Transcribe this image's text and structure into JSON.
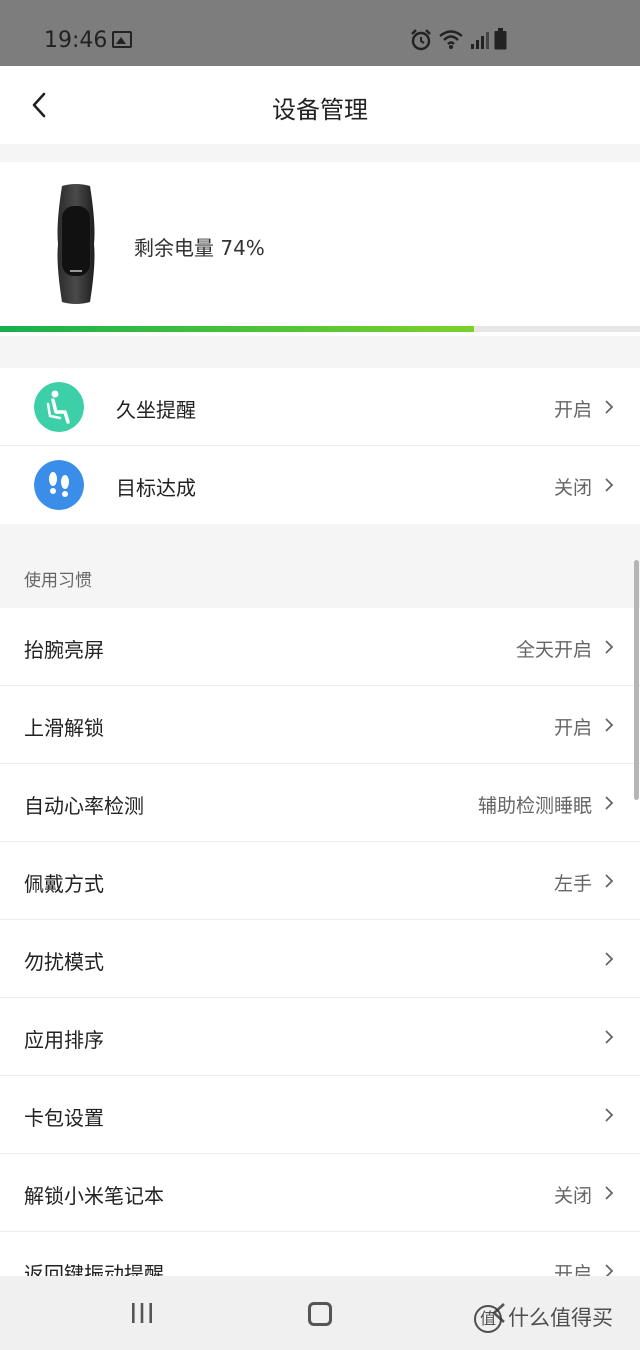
{
  "status_bar": {
    "time": "19:46",
    "icons": [
      "gallery-icon",
      "alarm-icon",
      "wifi-icon",
      "signal-icon",
      "battery-icon"
    ]
  },
  "header": {
    "title": "设备管理",
    "back_icon": "chevron-left-icon"
  },
  "device": {
    "battery_label": "剩余电量 74%",
    "battery_percent": 74,
    "progress_colors": [
      "#16b04d",
      "#7cd12a"
    ]
  },
  "reminders": [
    {
      "label": "久坐提醒",
      "value": "开启",
      "icon": "sitting-person-icon",
      "icon_color": "#3ccfa8"
    },
    {
      "label": "目标达成",
      "value": "关闭",
      "icon": "footprints-icon",
      "icon_color": "#3a8de8"
    }
  ],
  "habits_section": {
    "title": "使用习惯",
    "items": [
      {
        "label": "抬腕亮屏",
        "value": "全天开启"
      },
      {
        "label": "上滑解锁",
        "value": "开启"
      },
      {
        "label": "自动心率检测",
        "value": "辅助检测睡眠"
      },
      {
        "label": "佩戴方式",
        "value": "左手"
      },
      {
        "label": "勿扰模式",
        "value": ""
      },
      {
        "label": "应用排序",
        "value": ""
      },
      {
        "label": "卡包设置",
        "value": ""
      },
      {
        "label": "解锁小米笔记本",
        "value": "关闭"
      },
      {
        "label": "返回键振动提醒",
        "value": "开启"
      }
    ]
  },
  "navbar": {
    "icons": [
      "recent-apps-icon",
      "home-icon",
      "back-icon"
    ]
  },
  "watermark": {
    "logo": "值",
    "text": "什么值得买"
  }
}
